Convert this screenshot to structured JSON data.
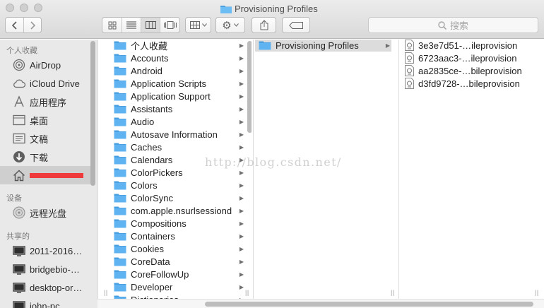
{
  "window": {
    "title": "Provisioning Profiles"
  },
  "toolbar": {
    "nav": {
      "back_icon": "chevron-left-icon",
      "forward_icon": "chevron-right-icon"
    },
    "view_modes": [
      "icon-view-icon",
      "list-view-icon",
      "column-view-icon",
      "coverflow-view-icon"
    ],
    "active_view": "column-view",
    "arrange_icon": "grid-arrange-icon",
    "action_icon": "gear-icon",
    "share_icon": "share-icon",
    "tag_icon": "tag-icon",
    "search_placeholder": "搜索"
  },
  "sidebar": {
    "favorites_header": "个人收藏",
    "favorites": [
      {
        "label": "AirDrop",
        "icon": "airdrop-icon"
      },
      {
        "label": "iCloud Drive",
        "icon": "cloud-icon"
      },
      {
        "label": "应用程序",
        "icon": "applications-icon"
      },
      {
        "label": "桌面",
        "icon": "desktop-icon"
      },
      {
        "label": "文稿",
        "icon": "documents-icon"
      },
      {
        "label": "下载",
        "icon": "download-icon"
      },
      {
        "label": "",
        "icon": "home-icon",
        "selected": true
      }
    ],
    "devices_header": "设备",
    "devices": [
      {
        "label": "远程光盘",
        "icon": "disc-icon"
      }
    ],
    "shared_header": "共享的",
    "shared": [
      {
        "label": "2011-2016…",
        "icon": "computer-icon"
      },
      {
        "label": "bridgebio-…",
        "icon": "computer-icon"
      },
      {
        "label": "desktop-or…",
        "icon": "computer-icon"
      },
      {
        "label": "john-pc",
        "icon": "computer-icon"
      }
    ]
  },
  "columns": {
    "library": [
      "个人收藏",
      "Accounts",
      "Android",
      "Application Scripts",
      "Application Support",
      "Assistants",
      "Audio",
      "Autosave Information",
      "Caches",
      "Calendars",
      "ColorPickers",
      "Colors",
      "ColorSync",
      "com.apple.nsurlsessiond",
      "Compositions",
      "Containers",
      "Cookies",
      "CoreData",
      "CoreFollowUp",
      "Developer",
      "Dictionaries"
    ],
    "mobiledevice": [
      "Provisioning Profiles"
    ],
    "profiles": [
      "3e3e7d51-…ileprovision",
      "6723aac3-…ileprovision",
      "aa2835ce-…bileprovision",
      "d3fd9728-…bileprovision"
    ]
  },
  "watermark": "http://blog.csdn.net/",
  "colors": {
    "folder": "#5fb3f0",
    "folder_tab": "#4aa0e0",
    "selection": "#dcdcdc",
    "redaction": "#f0393a"
  }
}
